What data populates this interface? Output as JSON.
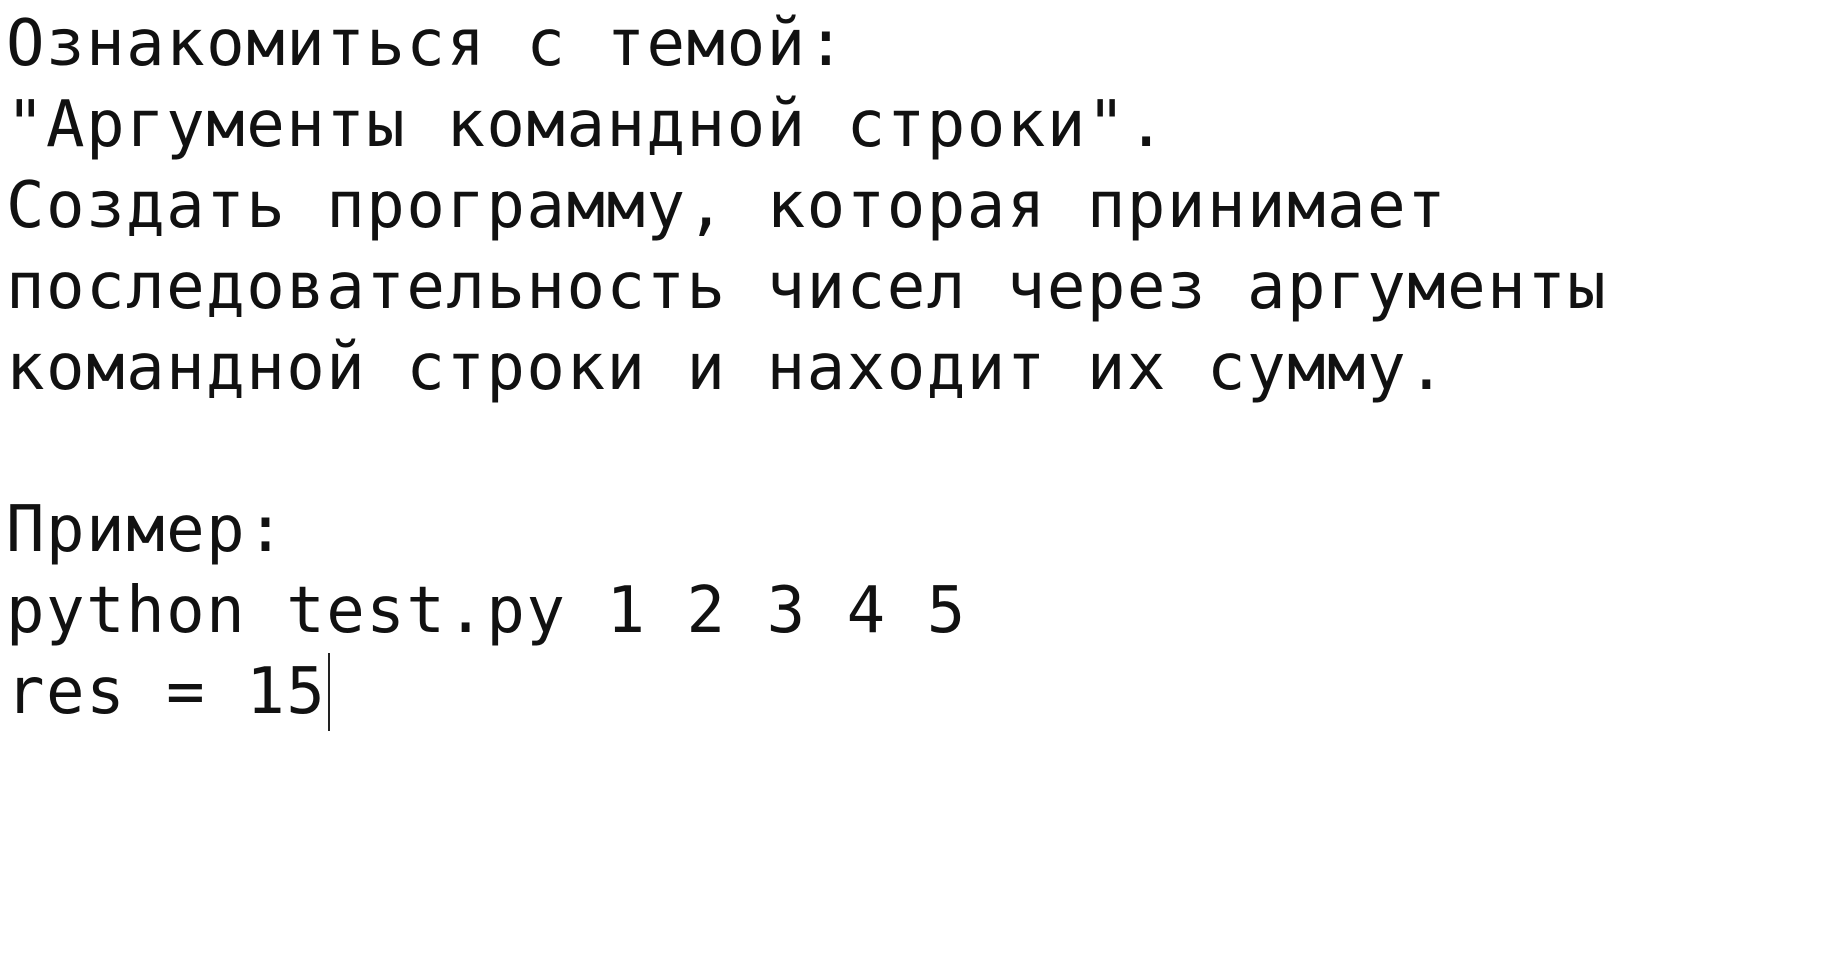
{
  "document": {
    "lines": [
      "Ознакомиться с темой:",
      "\"Аргументы командной строки\".",
      "Создать программу, которая принимает",
      "последовательность чисел через аргументы",
      "командной строки и находит их сумму.",
      "",
      "Пример:",
      "python test.py 1 2 3 4 5",
      "res = 15"
    ]
  }
}
